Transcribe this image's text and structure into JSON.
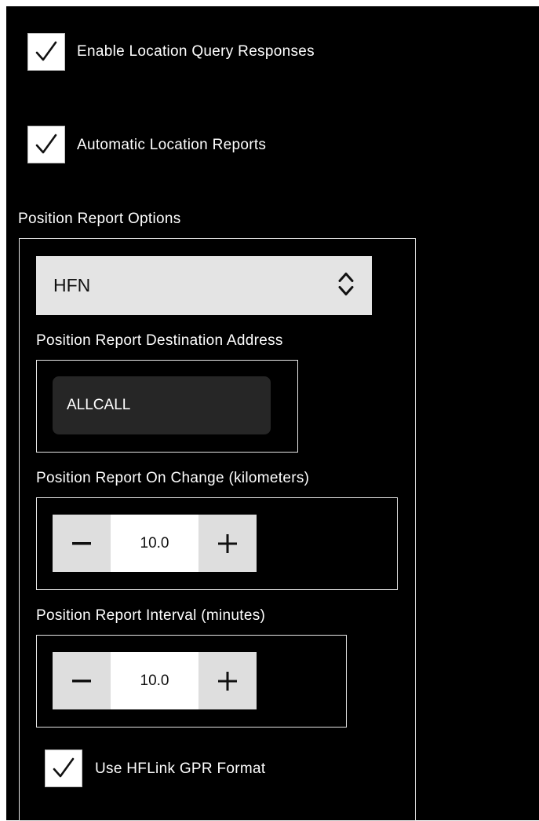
{
  "options": {
    "enable_location_query": {
      "label": "Enable Location Query Responses",
      "checked": true
    },
    "automatic_location_reports": {
      "label": "Automatic Location Reports",
      "checked": true
    }
  },
  "position_report": {
    "section_title": "Position Report Options",
    "network_select": {
      "value": "HFN",
      "icon": "chevron-up-down-icon"
    },
    "destination": {
      "label": "Position Report Destination Address",
      "value": "ALLCALL"
    },
    "on_change": {
      "label": "Position Report On Change (kilometers)",
      "value": "10.0",
      "decrement_icon": "minus-icon",
      "increment_icon": "plus-icon"
    },
    "interval": {
      "label": "Position Report Interval (minutes)",
      "value": "10.0",
      "decrement_icon": "minus-icon",
      "increment_icon": "plus-icon"
    },
    "gpr_format": {
      "label": "Use HFLink GPR Format",
      "checked": true
    }
  },
  "colors": {
    "background": "#000000",
    "control_light": "#e4e4e4",
    "input_dark": "#262626",
    "text": "#ffffff"
  }
}
